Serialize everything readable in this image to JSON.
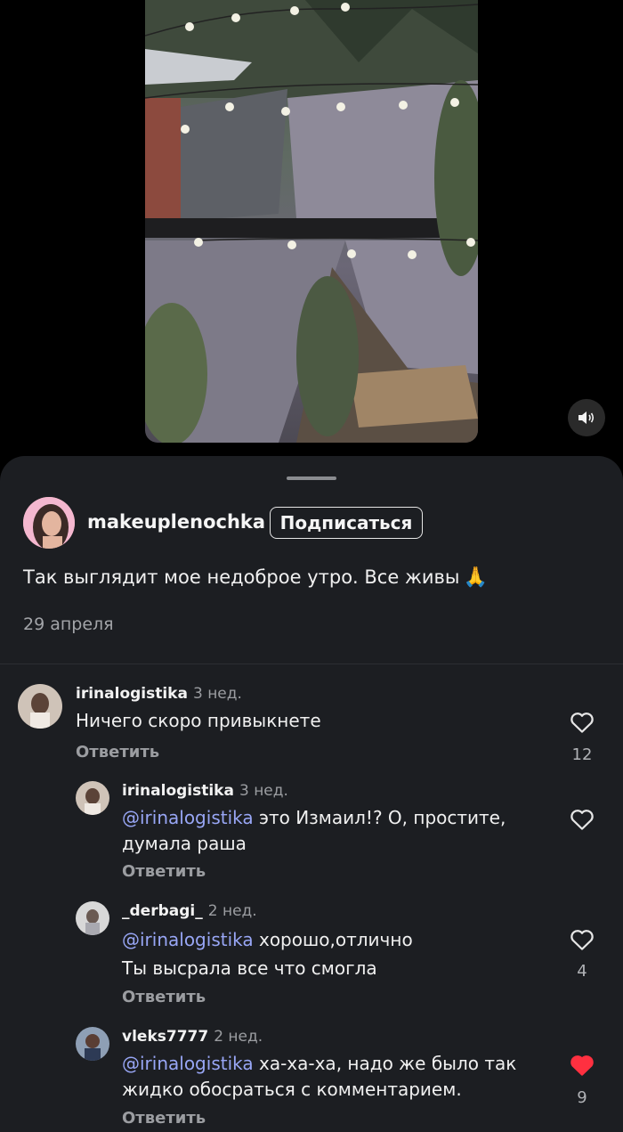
{
  "video": {
    "sound_icon": "speaker-icon"
  },
  "post": {
    "author": "makeuplenochka",
    "follow_label": "Подписаться",
    "caption": "Так выглядит мое недоброе утро. Все живы",
    "caption_emoji": "🙏",
    "date": "29 апреля"
  },
  "comments": [
    {
      "user": "irinalogistika",
      "time": "3 нед.",
      "mention": "",
      "text_line1": "Ничего скоро привыкнете",
      "text_line2": "",
      "reply_label": "Ответить",
      "likes": "12",
      "liked": false
    },
    {
      "user": "irinalogistika",
      "time": "3 нед.",
      "mention": "@irinalogistika",
      "text_line1": " это Измаил!? О, простите,",
      "text_line2": "думала раша",
      "reply_label": "Ответить",
      "likes": "",
      "liked": false
    },
    {
      "user": "_derbagi_",
      "time": "2 нед.",
      "mention": "@irinalogistika",
      "text_line1": " хорошо,отлично",
      "text_line2": "Ты высрала все что смогла",
      "reply_label": "Ответить",
      "likes": "4",
      "liked": false
    },
    {
      "user": "vleks7777",
      "time": "2 нед.",
      "mention": "@irinalogistika",
      "text_line1": " ха-ха-ха, надо же было так",
      "text_line2": "жидко обосраться с комментарием.",
      "reply_label": "Ответить",
      "likes": "9",
      "liked": true
    }
  ],
  "colors": {
    "sheet_bg": "#1c1e22",
    "mention": "#98a6f5",
    "liked_heart": "#ff3040"
  }
}
